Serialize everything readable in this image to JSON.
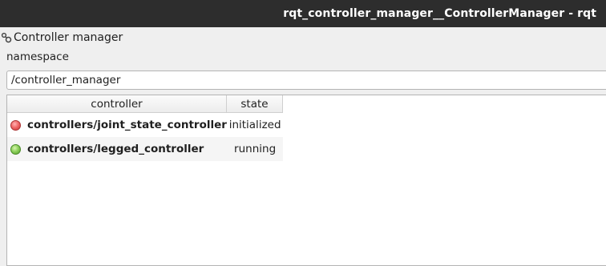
{
  "window": {
    "title": "rqt_controller_manager__ControllerManager - rqt"
  },
  "plugin": {
    "title": "Controller manager",
    "icon": "gear-plugin-icon"
  },
  "namespace": {
    "label": "namespace",
    "value": "/controller_manager"
  },
  "table": {
    "columns": [
      "controller",
      "state"
    ],
    "rows": [
      {
        "name": "controllers/joint_state_controller",
        "state": "initialized",
        "status_color": "#e05555"
      },
      {
        "name": "controllers/legged_controller",
        "state": "running",
        "status_color": "#7cc24a"
      }
    ]
  }
}
